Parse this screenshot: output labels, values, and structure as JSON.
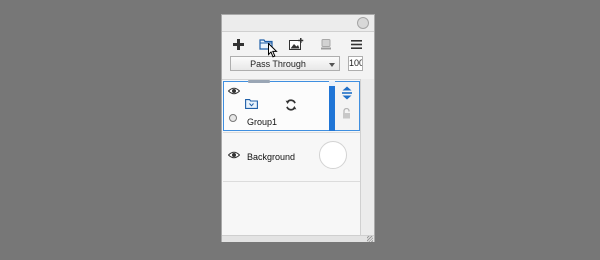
{
  "panel": {
    "toolbar": {
      "add_icon": "plus-icon",
      "group_icon": "folder-icon",
      "image_icon": "image-add-icon",
      "eraser_icon": "eraser-icon",
      "menu_icon": "hamburger-menu-icon"
    },
    "blend_mode": "Pass Through",
    "opacity": "100"
  },
  "layers": [
    {
      "name": "Group1",
      "type": "group",
      "selected": true
    },
    {
      "name": "Background",
      "type": "layer",
      "selected": false
    }
  ],
  "colors": {
    "accent": "#1f75d6",
    "selection_border": "#3f8fe0",
    "background": "#777777"
  }
}
